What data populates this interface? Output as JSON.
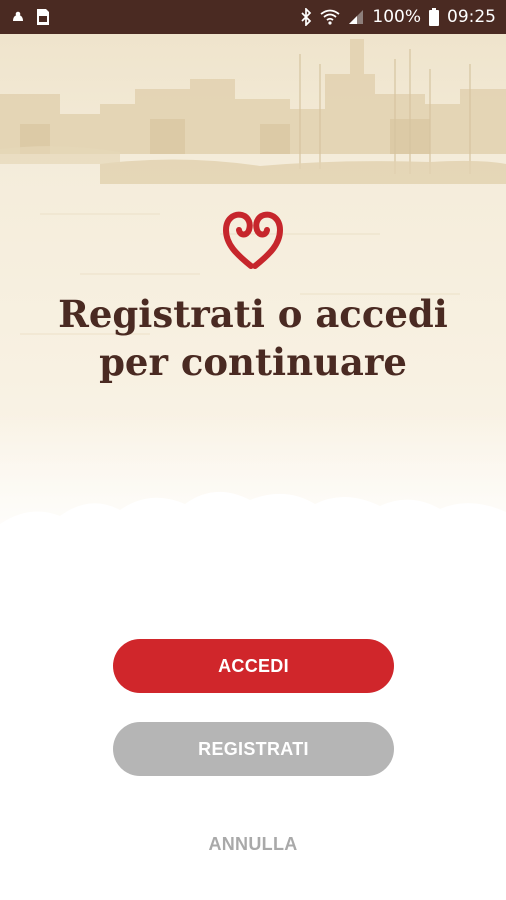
{
  "status_bar": {
    "battery_percent": "100%",
    "time": "09:25",
    "icons": [
      "notification-icon",
      "sim-icon",
      "bluetooth-icon",
      "wifi-icon",
      "signal-icon",
      "battery-icon"
    ]
  },
  "hero": {
    "headline_line1": "Registrati o accedi",
    "headline_line2": "per continuare",
    "logo_icon": "hearts-logo-icon"
  },
  "actions": {
    "login_label": "ACCEDI",
    "register_label": "REGISTRATI",
    "cancel_label": "ANNULLA"
  },
  "colors": {
    "status_bar": "#4a2a22",
    "primary": "#d0262b",
    "secondary": "#b5b5b5",
    "text_dark": "#4a2a22",
    "cancel_text": "#a9a9a9"
  }
}
